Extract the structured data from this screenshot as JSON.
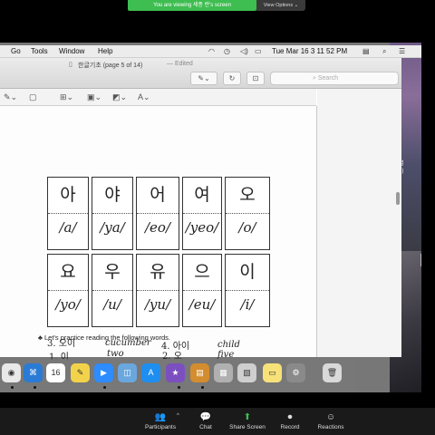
{
  "zoom": {
    "banner": "You are viewing 세종 란's screen",
    "view_options": "View Options ⌄",
    "toolbar": [
      {
        "label": "Participants",
        "icon": "👥",
        "caret": "^"
      },
      {
        "label": "Chat",
        "icon": "💬"
      },
      {
        "label": "Share Screen",
        "icon": "⬆"
      },
      {
        "label": "Record",
        "icon": "⏺"
      },
      {
        "label": "Reactions",
        "icon": "☺"
      }
    ]
  },
  "mac": {
    "menu": [
      "Go",
      "Tools",
      "Window",
      "Help"
    ],
    "clock": "Tue Mar 16  3 11 52 PM",
    "desktop_text": "별\nn)"
  },
  "preview": {
    "title": "한글기초 (page 5 of 14)",
    "edited": "— Edited",
    "search_placeholder": "Search",
    "toolbar2": [
      "✎⌄",
      "▢",
      "⊞⌄",
      "▣⌄",
      "◩⌄",
      "A⌄"
    ]
  },
  "worksheet": {
    "row1": [
      {
        "hangul": "아",
        "roman": "/a/"
      },
      {
        "hangul": "야",
        "roman": "/ya/"
      },
      {
        "hangul": "어",
        "roman": "/eo/"
      },
      {
        "hangul": "여",
        "roman": "/yeo/"
      },
      {
        "hangul": "오",
        "roman": "/o/"
      }
    ],
    "row2": [
      {
        "hangul": "요",
        "roman": "/yo/"
      },
      {
        "hangul": "우",
        "roman": "/u/"
      },
      {
        "hangul": "유",
        "roman": "/yu/"
      },
      {
        "hangul": "으",
        "roman": "/eu/"
      },
      {
        "hangul": "이",
        "roman": "/i/"
      }
    ],
    "practice_heading": "♣ Let's practice reading the following words.",
    "words": [
      {
        "item": "1. 이",
        "answer": "two"
      },
      {
        "item": "2. 오",
        "answer": "five"
      },
      {
        "item": "3. 오이",
        "answer": "cucumber"
      },
      {
        "item": "4. 아이",
        "answer": "child"
      }
    ]
  },
  "dock": [
    {
      "name": "chrome-icon",
      "color": "#e9e9e9",
      "glyph": "◉"
    },
    {
      "name": "app-store-icon",
      "color": "#2a7bd6",
      "glyph": "⌘"
    },
    {
      "name": "calendar-icon",
      "color": "#ffffff",
      "glyph": "16"
    },
    {
      "name": "stickies-icon",
      "color": "#f2d24a",
      "glyph": "✎"
    },
    {
      "name": "zoom-icon",
      "color": "#2d8cff",
      "glyph": "▶"
    },
    {
      "name": "preview-icon",
      "color": "#6aa7de",
      "glyph": "◫"
    },
    {
      "name": "appstore-icon",
      "color": "#1f8ef1",
      "glyph": "A"
    },
    {
      "name": "imovie-icon",
      "color": "#7b4fc0",
      "glyph": "★"
    },
    {
      "name": "keynote-icon",
      "color": "#d38d2e",
      "glyph": "▤"
    },
    {
      "name": "photos-icon",
      "color": "#b0b0b0",
      "glyph": "▦"
    },
    {
      "name": "preview-files-icon",
      "color": "#cfcfcf",
      "glyph": "▧"
    },
    {
      "name": "notes-icon",
      "color": "#f7e27a",
      "glyph": "▭"
    },
    {
      "name": "system-pref-icon",
      "color": "#8a8a8a",
      "glyph": "⚙"
    },
    {
      "name": "trash-icon",
      "color": "#d9d9d9",
      "glyph": "🗑"
    }
  ]
}
